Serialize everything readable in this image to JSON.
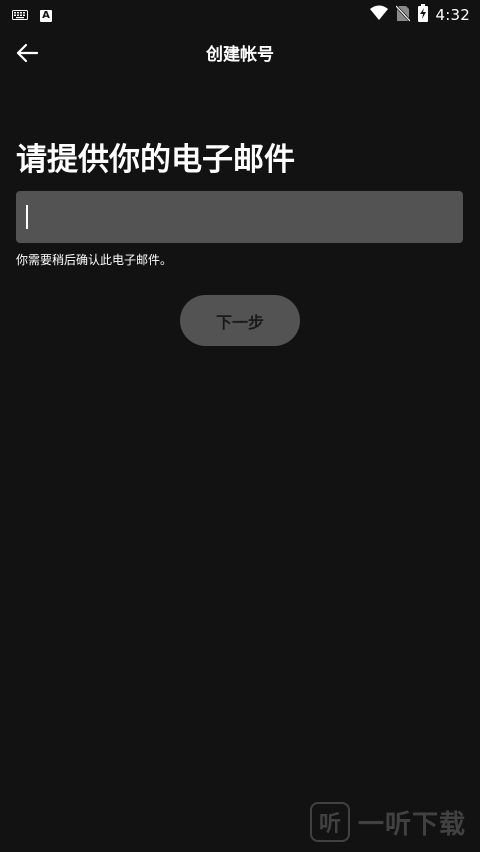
{
  "status_bar": {
    "time": "4:32",
    "notification_badge": "A",
    "icons": [
      "keyboard-icon",
      "a-notification-icon",
      "wifi-icon",
      "no-sim-icon",
      "battery-charging-icon"
    ]
  },
  "app_bar": {
    "title": "创建帐号",
    "back_icon": "arrow-left-icon"
  },
  "main": {
    "heading": "请提供你的电子邮件",
    "email_input": {
      "value": "",
      "placeholder": ""
    },
    "hint": "你需要稍后确认此电子邮件。",
    "next_button_label": "下一步"
  },
  "watermark": {
    "logo_glyph": "听",
    "text": "一听下载"
  },
  "colors": {
    "background": "#121212",
    "input_background": "#535353",
    "button_background": "#535353",
    "button_text": "#1a1a1a",
    "text": "#ffffff"
  }
}
